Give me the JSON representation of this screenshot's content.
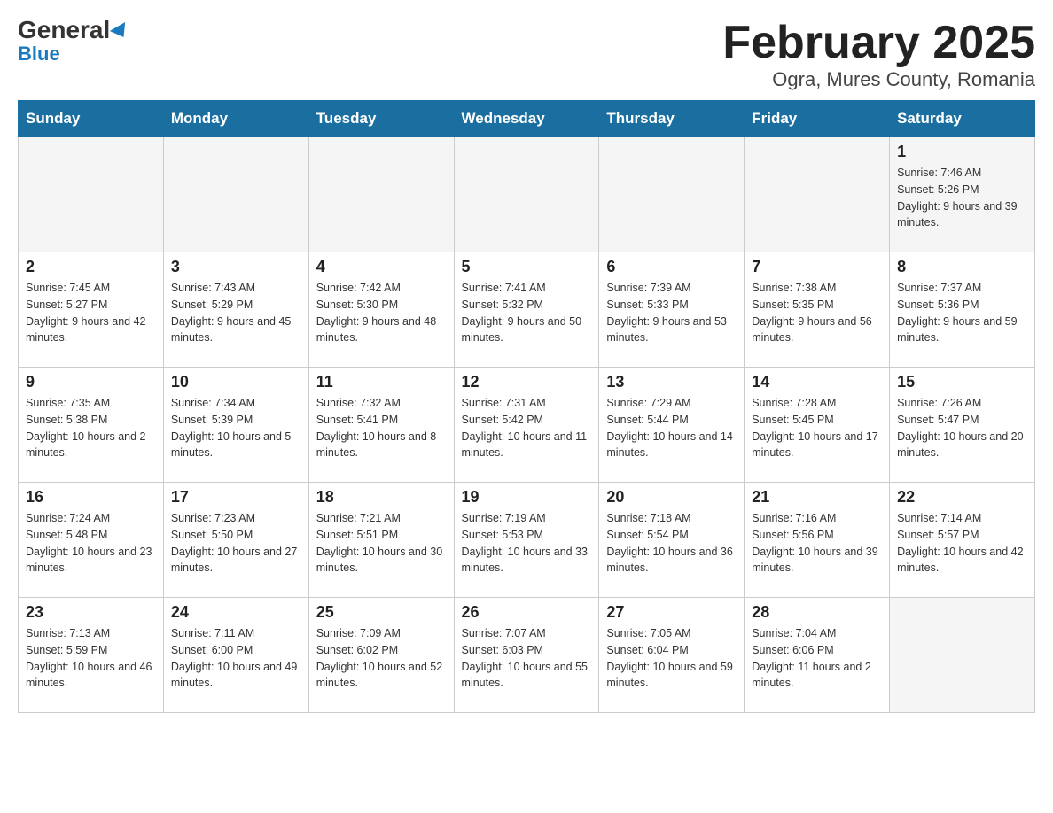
{
  "header": {
    "logo_general": "General",
    "logo_blue": "Blue",
    "title": "February 2025",
    "subtitle": "Ogra, Mures County, Romania"
  },
  "days_of_week": [
    "Sunday",
    "Monday",
    "Tuesday",
    "Wednesday",
    "Thursday",
    "Friday",
    "Saturday"
  ],
  "weeks": [
    {
      "days": [
        {
          "date": "",
          "info": ""
        },
        {
          "date": "",
          "info": ""
        },
        {
          "date": "",
          "info": ""
        },
        {
          "date": "",
          "info": ""
        },
        {
          "date": "",
          "info": ""
        },
        {
          "date": "",
          "info": ""
        },
        {
          "date": "1",
          "info": "Sunrise: 7:46 AM\nSunset: 5:26 PM\nDaylight: 9 hours and 39 minutes."
        }
      ]
    },
    {
      "days": [
        {
          "date": "2",
          "info": "Sunrise: 7:45 AM\nSunset: 5:27 PM\nDaylight: 9 hours and 42 minutes."
        },
        {
          "date": "3",
          "info": "Sunrise: 7:43 AM\nSunset: 5:29 PM\nDaylight: 9 hours and 45 minutes."
        },
        {
          "date": "4",
          "info": "Sunrise: 7:42 AM\nSunset: 5:30 PM\nDaylight: 9 hours and 48 minutes."
        },
        {
          "date": "5",
          "info": "Sunrise: 7:41 AM\nSunset: 5:32 PM\nDaylight: 9 hours and 50 minutes."
        },
        {
          "date": "6",
          "info": "Sunrise: 7:39 AM\nSunset: 5:33 PM\nDaylight: 9 hours and 53 minutes."
        },
        {
          "date": "7",
          "info": "Sunrise: 7:38 AM\nSunset: 5:35 PM\nDaylight: 9 hours and 56 minutes."
        },
        {
          "date": "8",
          "info": "Sunrise: 7:37 AM\nSunset: 5:36 PM\nDaylight: 9 hours and 59 minutes."
        }
      ]
    },
    {
      "days": [
        {
          "date": "9",
          "info": "Sunrise: 7:35 AM\nSunset: 5:38 PM\nDaylight: 10 hours and 2 minutes."
        },
        {
          "date": "10",
          "info": "Sunrise: 7:34 AM\nSunset: 5:39 PM\nDaylight: 10 hours and 5 minutes."
        },
        {
          "date": "11",
          "info": "Sunrise: 7:32 AM\nSunset: 5:41 PM\nDaylight: 10 hours and 8 minutes."
        },
        {
          "date": "12",
          "info": "Sunrise: 7:31 AM\nSunset: 5:42 PM\nDaylight: 10 hours and 11 minutes."
        },
        {
          "date": "13",
          "info": "Sunrise: 7:29 AM\nSunset: 5:44 PM\nDaylight: 10 hours and 14 minutes."
        },
        {
          "date": "14",
          "info": "Sunrise: 7:28 AM\nSunset: 5:45 PM\nDaylight: 10 hours and 17 minutes."
        },
        {
          "date": "15",
          "info": "Sunrise: 7:26 AM\nSunset: 5:47 PM\nDaylight: 10 hours and 20 minutes."
        }
      ]
    },
    {
      "days": [
        {
          "date": "16",
          "info": "Sunrise: 7:24 AM\nSunset: 5:48 PM\nDaylight: 10 hours and 23 minutes."
        },
        {
          "date": "17",
          "info": "Sunrise: 7:23 AM\nSunset: 5:50 PM\nDaylight: 10 hours and 27 minutes."
        },
        {
          "date": "18",
          "info": "Sunrise: 7:21 AM\nSunset: 5:51 PM\nDaylight: 10 hours and 30 minutes."
        },
        {
          "date": "19",
          "info": "Sunrise: 7:19 AM\nSunset: 5:53 PM\nDaylight: 10 hours and 33 minutes."
        },
        {
          "date": "20",
          "info": "Sunrise: 7:18 AM\nSunset: 5:54 PM\nDaylight: 10 hours and 36 minutes."
        },
        {
          "date": "21",
          "info": "Sunrise: 7:16 AM\nSunset: 5:56 PM\nDaylight: 10 hours and 39 minutes."
        },
        {
          "date": "22",
          "info": "Sunrise: 7:14 AM\nSunset: 5:57 PM\nDaylight: 10 hours and 42 minutes."
        }
      ]
    },
    {
      "days": [
        {
          "date": "23",
          "info": "Sunrise: 7:13 AM\nSunset: 5:59 PM\nDaylight: 10 hours and 46 minutes."
        },
        {
          "date": "24",
          "info": "Sunrise: 7:11 AM\nSunset: 6:00 PM\nDaylight: 10 hours and 49 minutes."
        },
        {
          "date": "25",
          "info": "Sunrise: 7:09 AM\nSunset: 6:02 PM\nDaylight: 10 hours and 52 minutes."
        },
        {
          "date": "26",
          "info": "Sunrise: 7:07 AM\nSunset: 6:03 PM\nDaylight: 10 hours and 55 minutes."
        },
        {
          "date": "27",
          "info": "Sunrise: 7:05 AM\nSunset: 6:04 PM\nDaylight: 10 hours and 59 minutes."
        },
        {
          "date": "28",
          "info": "Sunrise: 7:04 AM\nSunset: 6:06 PM\nDaylight: 11 hours and 2 minutes."
        },
        {
          "date": "",
          "info": ""
        }
      ]
    }
  ]
}
